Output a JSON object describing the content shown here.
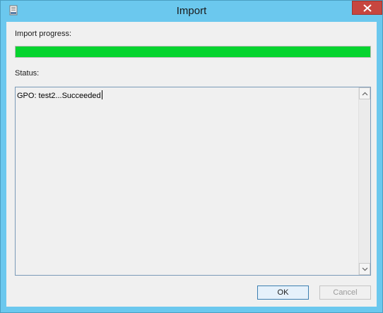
{
  "window": {
    "title": "Import"
  },
  "labels": {
    "progress": "Import progress:",
    "status": "Status:"
  },
  "progress": {
    "fraction": 1.0,
    "color": "#06d42f"
  },
  "status": {
    "text": "GPO: test2...Succeeded"
  },
  "buttons": {
    "ok": "OK",
    "cancel": "Cancel"
  },
  "icons": {
    "app": "gpo-import-icon",
    "close": "close-icon",
    "scroll_up": "chevron-up-icon",
    "scroll_down": "chevron-down-icon"
  },
  "colors": {
    "titlebar": "#6bc8ee",
    "close": "#c7463f"
  }
}
